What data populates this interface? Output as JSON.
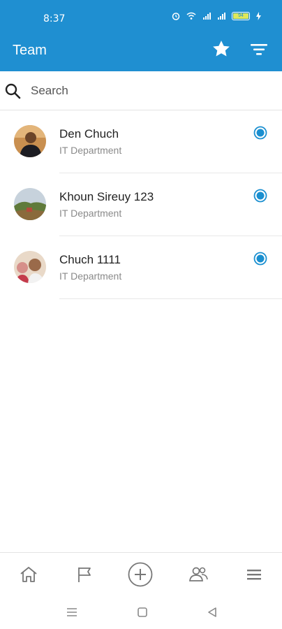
{
  "status_bar": {
    "time": "8:37",
    "battery_level": "94",
    "icons": [
      "alarm-icon",
      "wifi-icon",
      "signal-icon",
      "signal-icon",
      "battery-icon",
      "charging-icon"
    ]
  },
  "app_bar": {
    "title": "Team",
    "actions": [
      "star-icon",
      "filter-icon"
    ]
  },
  "search": {
    "placeholder": "Search",
    "value": ""
  },
  "members": [
    {
      "name": "Den Chuch",
      "department": "IT Department",
      "selected": true
    },
    {
      "name": "Khoun Sireuy 123",
      "department": "IT Department",
      "selected": true
    },
    {
      "name": "Chuch 1111",
      "department": "IT Department",
      "selected": true
    }
  ],
  "bottom_nav": [
    "home-icon",
    "flag-icon",
    "add-circle-icon",
    "team-icon",
    "menu-icon"
  ],
  "system_nav": [
    "recents-icon",
    "home-square-icon",
    "back-triangle-icon"
  ],
  "colors": {
    "primary": "#1f8fd1",
    "radio": "#1a8fd0",
    "icon_gray": "#777777",
    "battery_fill": "#dfe85a"
  }
}
